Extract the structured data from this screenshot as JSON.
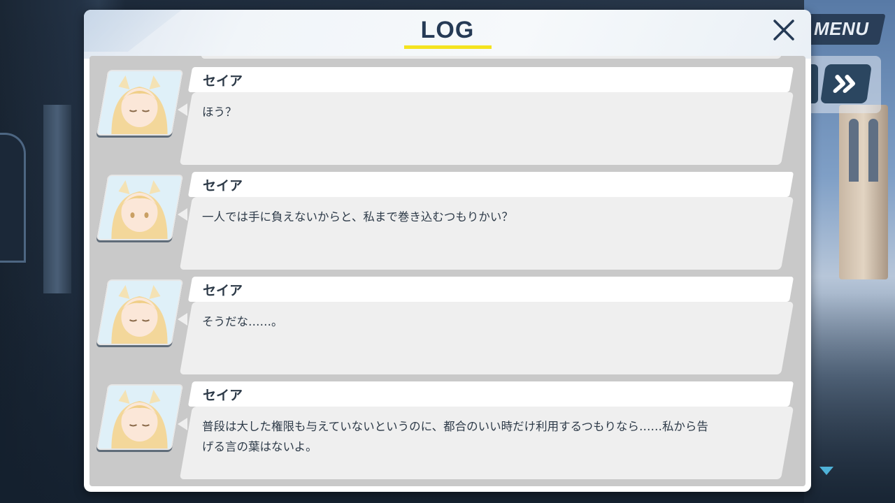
{
  "window": {
    "title": "LOG"
  },
  "controls": {
    "menu_label": "MENU",
    "close_icon": "close-icon",
    "skip_icon": "double-chevron-right-icon",
    "next_icon": "triangle-down-icon"
  },
  "colors": {
    "accent_underline": "#f4e31f",
    "title_text": "#253a55",
    "message_bg": "#efefef",
    "log_body_bg": "#c9c9c9"
  },
  "entries": [
    {
      "speaker": "セイア",
      "text": "ほう？"
    },
    {
      "speaker": "セイア",
      "text": "一人では手に負えないからと、私まで巻き込むつもりかい？"
    },
    {
      "speaker": "セイア",
      "text": "そうだな……。"
    },
    {
      "speaker": "セイア",
      "text": "普段は大した権限も与えていないというのに、都合のいい時だけ利用するつもりなら……私から告げる言の葉はないよ。"
    }
  ]
}
